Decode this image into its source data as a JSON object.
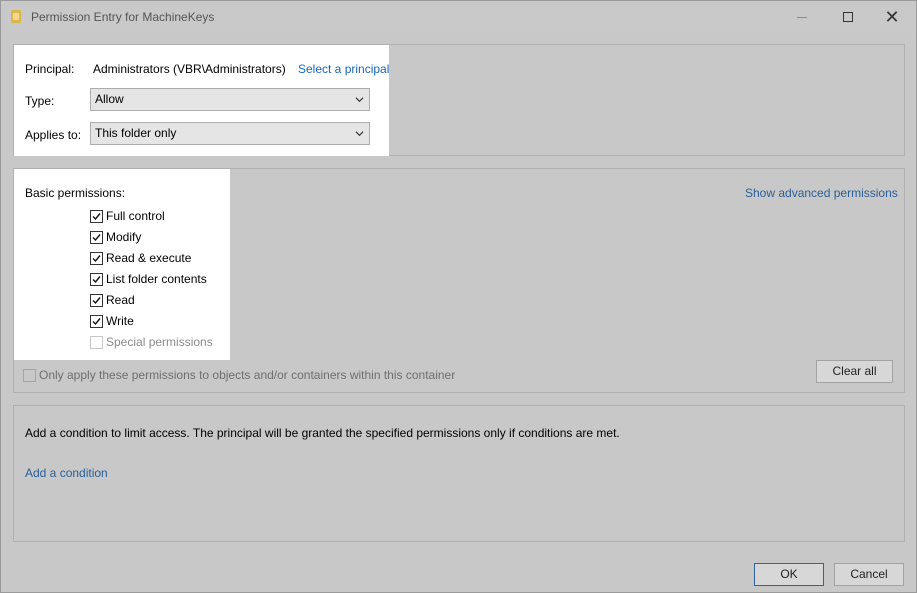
{
  "window": {
    "title": "Permission Entry for MachineKeys"
  },
  "principal": {
    "label": "Principal:",
    "value": "Administrators (VBR\\Administrators)",
    "select_link": "Select a principal"
  },
  "type": {
    "label": "Type:",
    "selected": "Allow"
  },
  "applies_to": {
    "label": "Applies to:",
    "selected": "This folder only"
  },
  "permissions": {
    "heading": "Basic permissions:",
    "show_advanced_link": "Show advanced permissions",
    "items": [
      {
        "label": "Full control",
        "checked": true,
        "enabled": true
      },
      {
        "label": "Modify",
        "checked": true,
        "enabled": true
      },
      {
        "label": "Read & execute",
        "checked": true,
        "enabled": true
      },
      {
        "label": "List folder contents",
        "checked": true,
        "enabled": true
      },
      {
        "label": "Read",
        "checked": true,
        "enabled": true
      },
      {
        "label": "Write",
        "checked": true,
        "enabled": true
      },
      {
        "label": "Special permissions",
        "checked": false,
        "enabled": false
      }
    ],
    "only_apply_label": "Only apply these permissions to objects and/or containers within this container",
    "clear_all_label": "Clear all"
  },
  "condition": {
    "text": "Add a condition to limit access. The principal will be granted the specified permissions only if conditions are met.",
    "add_link": "Add a condition"
  },
  "footer": {
    "ok_label": "OK",
    "cancel_label": "Cancel"
  }
}
